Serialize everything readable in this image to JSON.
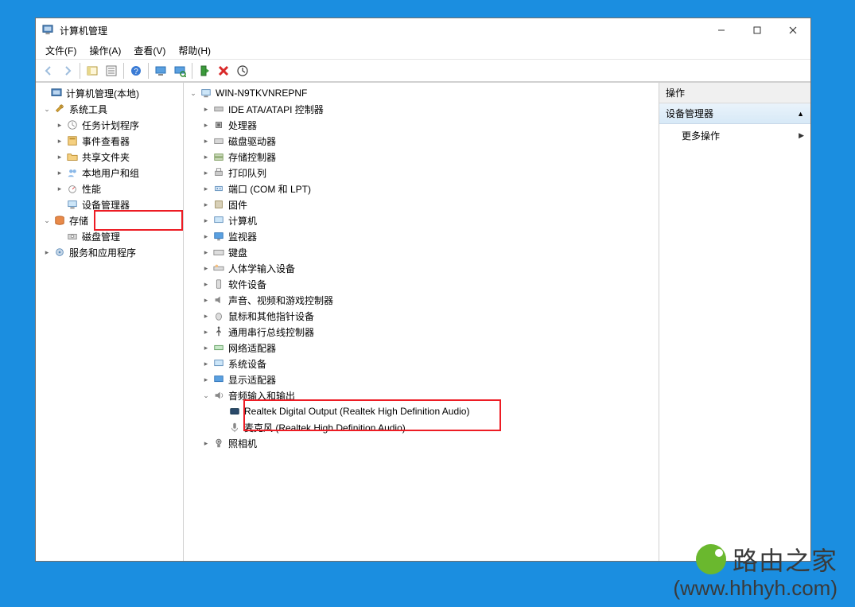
{
  "window": {
    "title": "计算机管理"
  },
  "menus": {
    "file": "文件(F)",
    "action": "操作(A)",
    "view": "查看(V)",
    "help": "帮助(H)"
  },
  "left_tree": {
    "root": "计算机管理(本地)",
    "sys_tools": "系统工具",
    "task_scheduler": "任务计划程序",
    "event_viewer": "事件查看器",
    "shared_folders": "共享文件夹",
    "local_users": "本地用户和组",
    "performance": "性能",
    "device_manager": "设备管理器",
    "storage": "存储",
    "disk_mgmt": "磁盘管理",
    "services_apps": "服务和应用程序"
  },
  "center_tree": {
    "computer": "WIN-N9TKVNREPNF",
    "ide": "IDE ATA/ATAPI 控制器",
    "processors": "处理器",
    "disk_drives": "磁盘驱动器",
    "storage_ctrl": "存储控制器",
    "print_queues": "打印队列",
    "ports": "端口 (COM 和 LPT)",
    "firmware": "固件",
    "computers": "计算机",
    "monitors": "监视器",
    "keyboards": "键盘",
    "hid": "人体学输入设备",
    "software_devices": "软件设备",
    "sound_video_game": "声音、视频和游戏控制器",
    "mice": "鼠标和其他指针设备",
    "usb_ctrl": "通用串行总线控制器",
    "network": "网络适配器",
    "system_devices": "系统设备",
    "display": "显示适配器",
    "audio_io": "音频输入和输出",
    "audio1": "Realtek Digital Output (Realtek High Definition Audio)",
    "audio2": "麦克风 (Realtek High Definition Audio)",
    "cameras": "照相机"
  },
  "actions": {
    "header": "操作",
    "subheader": "设备管理器",
    "more": "更多操作"
  },
  "watermark": {
    "line1": "路由之家",
    "line2": "(www.hhhyh.com)"
  }
}
